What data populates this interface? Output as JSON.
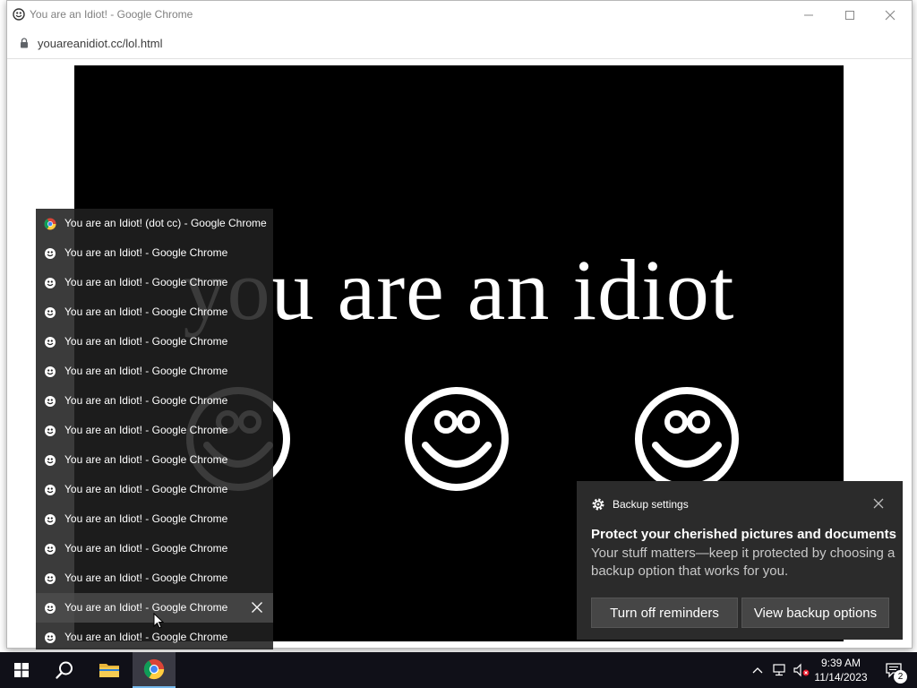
{
  "window": {
    "title": "You are an Idiot! - Google Chrome",
    "url": "youareanidiot.cc/lol.html"
  },
  "page": {
    "headline": "you are an idiot"
  },
  "jump_list": {
    "items": [
      {
        "label": "You are an Idiot! (dot cc) - Google Chrome",
        "icon": "chrome-icon"
      },
      {
        "label": "You are an Idiot! - Google Chrome",
        "icon": "smiley-icon"
      },
      {
        "label": "You are an Idiot! - Google Chrome",
        "icon": "smiley-icon"
      },
      {
        "label": "You are an Idiot! - Google Chrome",
        "icon": "smiley-icon"
      },
      {
        "label": "You are an Idiot! - Google Chrome",
        "icon": "smiley-icon"
      },
      {
        "label": "You are an Idiot! - Google Chrome",
        "icon": "smiley-icon"
      },
      {
        "label": "You are an Idiot! - Google Chrome",
        "icon": "smiley-icon"
      },
      {
        "label": "You are an Idiot! - Google Chrome",
        "icon": "smiley-icon"
      },
      {
        "label": "You are an Idiot! - Google Chrome",
        "icon": "smiley-icon"
      },
      {
        "label": "You are an Idiot! - Google Chrome",
        "icon": "smiley-icon"
      },
      {
        "label": "You are an Idiot! - Google Chrome",
        "icon": "smiley-icon"
      },
      {
        "label": "You are an Idiot! - Google Chrome",
        "icon": "smiley-icon"
      },
      {
        "label": "You are an Idiot! - Google Chrome",
        "icon": "smiley-icon"
      },
      {
        "label": "You are an Idiot! - Google Chrome",
        "icon": "smiley-icon"
      },
      {
        "label": "You are an Idiot! - Google Chrome",
        "icon": "smiley-icon"
      }
    ]
  },
  "toast": {
    "app": "Backup settings",
    "heading": "Protect your cherished pictures and documents",
    "body": "Your stuff matters—keep it protected by choosing a backup option that works for you.",
    "button_dismiss": "Turn off reminders",
    "button_action": "View backup options"
  },
  "taskbar": {
    "time": "9:39 AM",
    "date": "11/14/2023",
    "notification_count": "2"
  }
}
